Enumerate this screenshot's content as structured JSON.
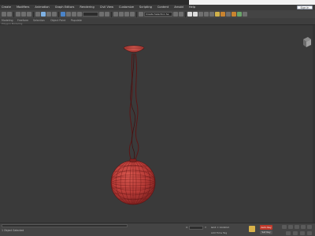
{
  "menu": {
    "items": [
      "Create",
      "Modifiers",
      "Animation",
      "Graph Editors",
      "Rendering",
      "Civil View",
      "Customize",
      "Scripting",
      "Content",
      "Arnold",
      "Help"
    ],
    "sign_in": "Sign In"
  },
  "toolbar": {
    "selection_set_placeholder": "Create Selection Se"
  },
  "ribbon": {
    "labels": [
      "Modeling",
      "Freeform",
      "Selection",
      "Object Paint",
      "Populate"
    ],
    "sublabels": [
      "Polygon Modeling"
    ]
  },
  "status": {
    "left_text": "1 Object Selected",
    "x_label": "X:",
    "y_label": "Y:",
    "z_label": "Z:",
    "grid_readout": "Grid = 10.0mm",
    "add_time_tag": "Add Time Tag",
    "auto_key": "Auto Key",
    "set_key": "Set Key"
  },
  "colors": {
    "object_red": "#b83a3a",
    "wire_dark": "#5a1010",
    "viewport_bg": "#3a3a3a"
  }
}
